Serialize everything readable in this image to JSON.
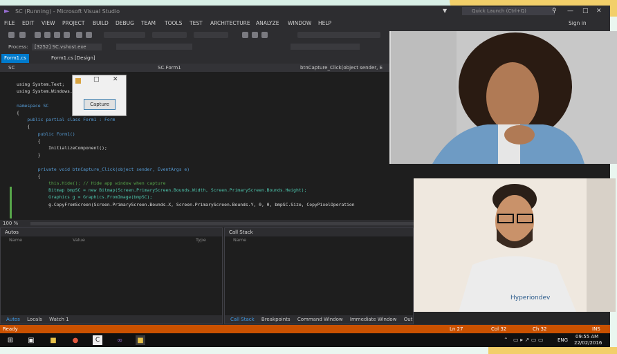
{
  "ide": {
    "title": "SC (Running) - Microsoft Visual Studio",
    "quick_launch": "Quick Launch (Ctrl+Q)",
    "sign_in": "Sign in",
    "menu": [
      "FILE",
      "EDIT",
      "VIEW",
      "PROJECT",
      "BUILD",
      "DEBUG",
      "TEAM",
      "TOOLS",
      "TEST",
      "ARCHITECTURE",
      "ANALYZE",
      "WINDOW",
      "HELP"
    ],
    "process": "Process:",
    "process_value": "[3252] SC.vshost.exe",
    "tabs": [
      "Form1.cs",
      "Form1.cs [Design]"
    ],
    "nav_left": "SC",
    "nav_mid": "SC.Form1",
    "nav_right": "btnCapture_Click(object sender, E",
    "zoom": "100 %"
  },
  "code_lines": [
    {
      "t": "using System.Text;"
    },
    {
      "t": "using System.Windows.Forms;"
    },
    {
      "t": ""
    },
    {
      "t": "namespace SC"
    },
    {
      "t": "{"
    },
    {
      "t": "    public partial class Form1 : Form"
    },
    {
      "t": "    {"
    },
    {
      "t": "        public Form1()"
    },
    {
      "t": "        {"
    },
    {
      "t": "            InitializeComponent();"
    },
    {
      "t": "        }"
    },
    {
      "t": ""
    },
    {
      "t": "        private void btnCapture_Click(object sender, EventArgs e)"
    },
    {
      "t": "        {"
    },
    {
      "t": "            this.Hide(); // Hide app window when capture"
    },
    {
      "t": "            Bitmap bmpSC = new Bitmap(Screen.PrimaryScreen.Bounds.Width, Screen.PrimaryScreen.Bounds.Height);"
    },
    {
      "t": "            Graphics g = Graphics.FromImage(bmpSC);"
    },
    {
      "t": "            g.CopyFromScreen(Screen.PrimaryScreen.Bounds.X, Screen.PrimaryScreen.Bounds.Y, 0, 0, bmpSC.Size, CopyPixelOperation"
    }
  ],
  "dialog": {
    "capture_label": "Capture"
  },
  "autos_panel": {
    "title": "Autos",
    "col_name": "Name",
    "col_value": "Value",
    "col_type": "Type",
    "tabs": [
      "Autos",
      "Locals",
      "Watch 1"
    ]
  },
  "callstack_panel": {
    "title": "Call Stack",
    "col_name": "Name",
    "tabs": [
      "Call Stack",
      "Breakpoints",
      "Command Window",
      "Immediate Window",
      "Output"
    ]
  },
  "status": {
    "left": "Ready",
    "ln": "Ln 27",
    "col": "Col 32",
    "ch": "Ch 32",
    "ins": "INS"
  },
  "taskbar": {
    "lang": "ENG",
    "time": "09:55 AM",
    "date": "22/02/2016"
  },
  "video2": {
    "shirt_text": "Hyperiondev"
  },
  "colors": {
    "accent": "#007acc",
    "status": "#ca5100"
  }
}
